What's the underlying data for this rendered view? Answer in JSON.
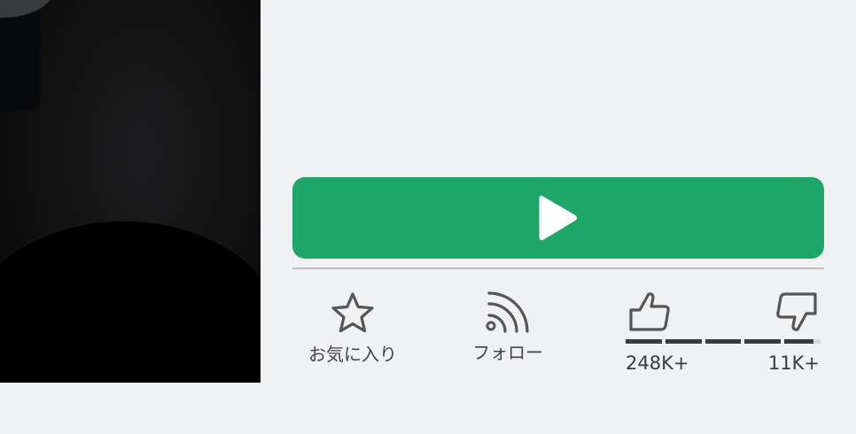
{
  "thumbnail": {
    "name": "game-thumbnail"
  },
  "play": {
    "icon": "play-icon",
    "color": "#1fa76a"
  },
  "actions": {
    "favorite": {
      "label": "お気に入り",
      "icon": "star-icon"
    },
    "follow": {
      "label": "フォロー",
      "icon": "rss-follow-icon"
    }
  },
  "votes": {
    "up_icon": "thumbs-up-icon",
    "down_icon": "thumbs-down-icon",
    "up_count": "248K+",
    "down_count": "11K+",
    "up_ratio": 0.96
  }
}
